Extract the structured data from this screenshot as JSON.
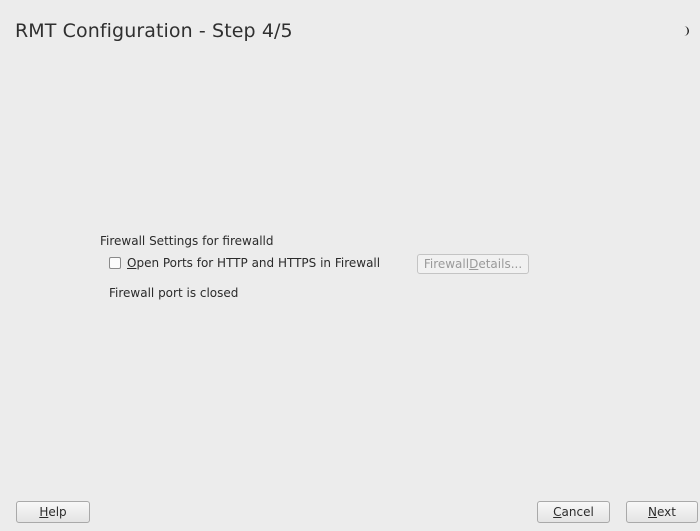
{
  "window": {
    "title": "RMT Configuration - Step 4/5"
  },
  "firewall": {
    "heading": "Firewall Settings for firewalld",
    "checkbox_access_key": "O",
    "checkbox_label_rest": "pen Ports for HTTP and HTTPS in Firewall",
    "checkbox_checked": false,
    "details_button_prefix": "Firewall ",
    "details_button_access_key": "D",
    "details_button_rest": "etails...",
    "details_enabled": false,
    "status": "Firewall port is closed"
  },
  "footer": {
    "help_access_key": "H",
    "help_rest": "elp",
    "cancel_access_key": "C",
    "cancel_rest": "ancel",
    "next_access_key": "N",
    "next_rest": "ext"
  },
  "icons": {
    "top_right": "moon-icon"
  }
}
